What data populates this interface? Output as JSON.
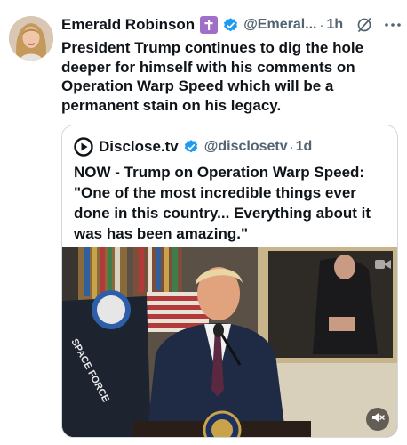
{
  "author": {
    "display_name": "Emerald Robinson",
    "handle": "@Emeral...",
    "time": "1h",
    "dot": "·",
    "cross_badge_color": "#a070c9",
    "verified_color": "#1d9bf0"
  },
  "tweet": {
    "text": "President Trump continues to dig the hole deeper for himself with his comments on Operation Warp Speed which will be a permanent stain on his legacy."
  },
  "quoted": {
    "display_name": "Disclose.tv",
    "handle": "@disclosetv",
    "time": "1d",
    "dot": "·",
    "text": "NOW - Trump on Operation Warp Speed: \"One of the most incredible things ever done in this country... Everything about it was has been amazing.\"",
    "media": {
      "type": "video",
      "seal_text": "PRESIDENT OF THE UNITED STATES",
      "flag_text": "SPACE FORCE"
    }
  },
  "icons": {
    "grok": "grok-icon",
    "more": "more-icon",
    "verified": "verified-badge-icon",
    "cross": "cross-icon",
    "mute": "muted-speaker-icon",
    "camera": "video-camera-icon"
  },
  "colors": {
    "text_primary": "#0f1419",
    "text_secondary": "#536471",
    "border": "#cfd9de",
    "accent": "#1d9bf0"
  }
}
